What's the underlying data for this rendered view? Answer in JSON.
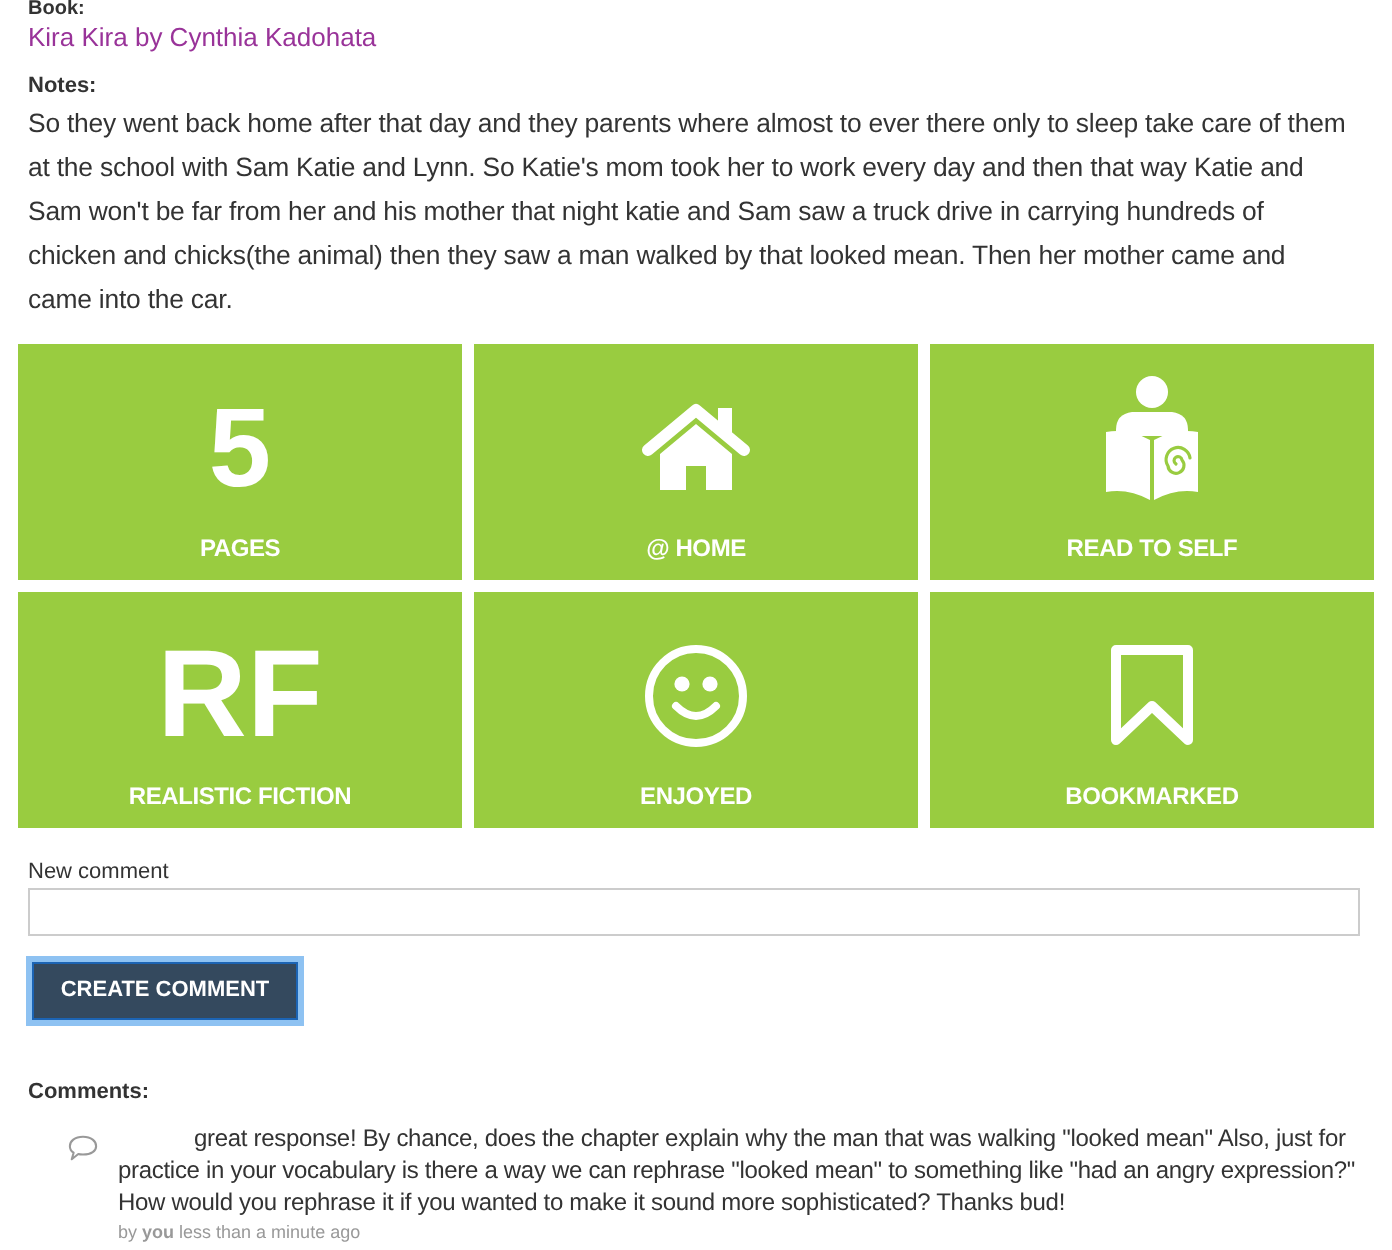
{
  "book": {
    "label": "Book:",
    "title": "Kira Kira by Cynthia Kadohata"
  },
  "notes": {
    "label": "Notes:",
    "text": "So they went back home after that day and they parents where almost to ever there only to sleep take care of them at the school with Sam Katie and Lynn. So Katie's mom took her to work every day and then that way Katie and Sam won't be far from her and his mother that night katie and Sam saw a truck drive in carrying hundreds of chicken and chicks(the animal) then they saw a man walked by that looked mean. Then her mother came and came into the car."
  },
  "tiles": [
    {
      "kind": "text",
      "value": "5",
      "label": "PAGES"
    },
    {
      "kind": "icon",
      "label": "@ HOME"
    },
    {
      "kind": "icon",
      "label": "READ TO SELF"
    },
    {
      "kind": "text",
      "value": "RF",
      "label": "REALISTIC FICTION"
    },
    {
      "kind": "icon",
      "label": "ENJOYED"
    },
    {
      "kind": "icon",
      "label": "BOOKMARKED"
    }
  ],
  "new_comment": {
    "label": "New comment",
    "button": {
      "label": "CREATE COMMENT",
      "focused": true
    }
  },
  "comments": {
    "label": "Comments:",
    "items": [
      {
        "text": "great response! By chance, does the chapter explain why the man that was walking \"looked mean\" Also, just for practice in your vocabulary is there a way we can rephrase \"looked mean\" to something like \"had an angry expression?\" How would you rephrase it if you wanted to make it sound more sophisticated? Thanks bud!",
        "meta": "by **you** less than a minute ago"
      }
    ]
  }
}
